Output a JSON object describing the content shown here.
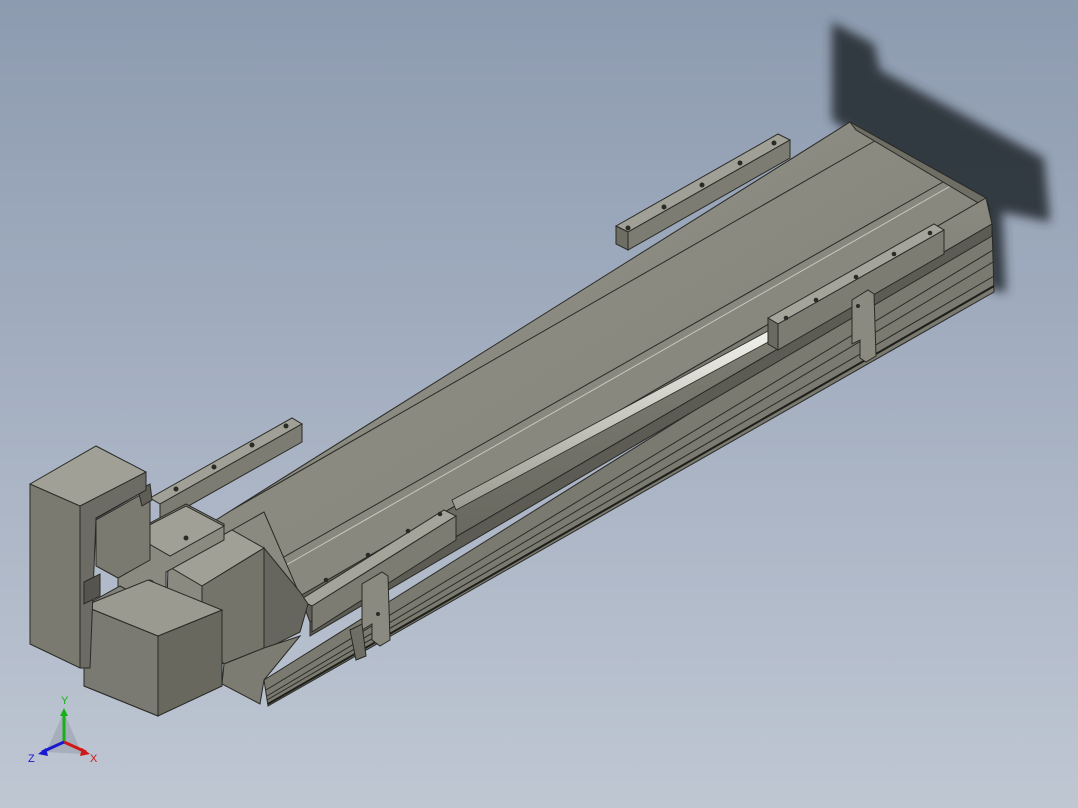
{
  "viewport": {
    "description_free": true,
    "background_top": "#8d9bb0",
    "background_bottom": "#bfc7d3"
  },
  "model": {
    "body_color": "#8a8a7e",
    "body_dark": "#6e6e64",
    "body_light": "#a4a49a",
    "edge_color": "#2a2a26",
    "shadow_color": "#2b3038",
    "rail_highlight": "#e6e6e0"
  },
  "triad": {
    "x_label": "X",
    "y_label": "Y",
    "z_label": "Z",
    "x_color": "#d01818",
    "y_color": "#18b018",
    "z_color": "#1818d0"
  }
}
